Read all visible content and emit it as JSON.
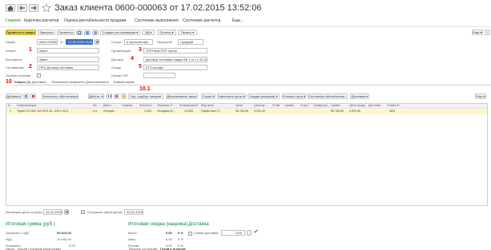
{
  "title": "Заказ клиента 0600-000063 от 17.02.2015 13:52:06",
  "nav": [
    "Главное",
    "Карточка расчетов",
    "Оценка рентабельности продажи",
    "Состояние выполнения",
    "Состояние расчетов",
    "Еще..."
  ],
  "toolbar": {
    "post_close": "Провести и закрыть",
    "save": "Записать",
    "post": "Провести",
    "create_based": "Создать на основании ▾",
    "price_list": "ЭД ▾",
    "reports": "Отчеты ▾",
    "print": "Печать ▾",
    "more": "Еще ▾",
    "help": "?"
  },
  "header": {
    "number_label": "Номер",
    "number_value": "0600-000063",
    "from_label": "от",
    "date_value": "17.02.2015 13:52:06",
    "status_label": "Статус",
    "status_value": "К выполнению",
    "priority_label": "Приоритет",
    "priority_value": "Средний",
    "client_label": "Клиент",
    "client_value": "Авист",
    "org_label": "Организация",
    "org_value": "ТОРГМАСТЕР Центр",
    "contragent_label": "Контрагент",
    "contragent_value": "Авист",
    "contract_label": "Договор",
    "contract_value": "Договор поставки товара № 1 от 17.02.2015",
    "agreement_label": "Соглашение",
    "agreement_value": "ПРЦ Договор поставки",
    "warehouse_label": "Склад",
    "warehouse_value": "КТЗ склады",
    "special_label": "Особые условия",
    "gpu_label": "Номер ГКП"
  },
  "markers": [
    "1",
    "2",
    "3",
    "4",
    "5",
    "10",
    "10.1"
  ],
  "tabs": [
    "Товары (1)",
    "Доставка",
    "Платежные реквизиты",
    "Дополнительно",
    "Комментарий"
  ],
  "table_toolbar": {
    "add": "Добавить",
    "fill_provision": "Заполнить обеспечение",
    "act": "Действ. ▾",
    "pick": "Упр. подбор товаров",
    "detail": "Детализовать заказ",
    "series": "Серии ▾",
    "fill_prices": "Заполнить цены ▾",
    "discounts": "Скидки (наценки) ▾",
    "cancel_rows": "Отмена строк ▾",
    "provision_state": "Состояние обеспечения...",
    "delivery": "Доставка ▾",
    "more": "Еще ▾"
  },
  "table": {
    "headers": [
      "N",
      "Номенклатура",
      "Ха...",
      "Дейст...",
      "Содерж...",
      "Количест...",
      "Упаковка, Е...",
      "Коэффициент",
      "Вид цены",
      "Цена",
      "Цена вр...",
      "% авт.",
      "Сумма ...",
      "% руч.",
      "Сумма руч...",
      "Сумма",
      "Цена прода...",
      "Доставка",
      "Ставка Н..."
    ],
    "rows": [
      [
        "1",
        "Trypta ТО 1007 АЗ SCR 15 - 310 х 20,0",
        "с.н.",
        "Отгрузи...",
        "",
        "1,000",
        "Отгрузка (О...",
        "13,000",
        "Прайс лист, Р...",
        "55 783,00",
        "4 291,00",
        "",
        "",
        "",
        "",
        "55 783,00",
        "4 291,00",
        "",
        "18%"
      ]
    ]
  },
  "shipping": {
    "label": "Желаемая дата отгрузки",
    "date": "20.02.2015",
    "one_date_label": "Отгружать одной датой:",
    "one_date_value": "20.02.2015"
  },
  "summary": {
    "total_title": "Итоговая сумма (руб.)",
    "with_vat_label": "Заказано с НДС",
    "with_vat_value": "65 823,94",
    "vat_label": "НДС",
    "vat_value": "10 040,94",
    "paid_label": "Отменено:",
    "paid_value": "0,00",
    "discount_title": "Итоговая скидка (наценка)",
    "total_label": "Всего:",
    "total_value": "0,00",
    "total_pct": "0 %",
    "auto_label": "Авто:",
    "auto_value": "0,00",
    "auto_pct": "0 %",
    "manual_label": "Ручная:",
    "manual_value": "0,00",
    "manual_pct": "0 %",
    "delivery_title": "Доставка",
    "delivery_sum_label": "Сумма доставки:",
    "delivery_sum_value": "0,00"
  },
  "footer": {
    "author_label": "Автор:",
    "author_value": "Вырей Геннадий Васильевич",
    "state_label": "Текущее состояние:",
    "state_value": "Готов к отгрузке"
  },
  "colors": {
    "accent": "#f2d84a",
    "marker": "#e00000",
    "row_highlight": "#fff5c2",
    "section_title": "#0a8a3a"
  }
}
